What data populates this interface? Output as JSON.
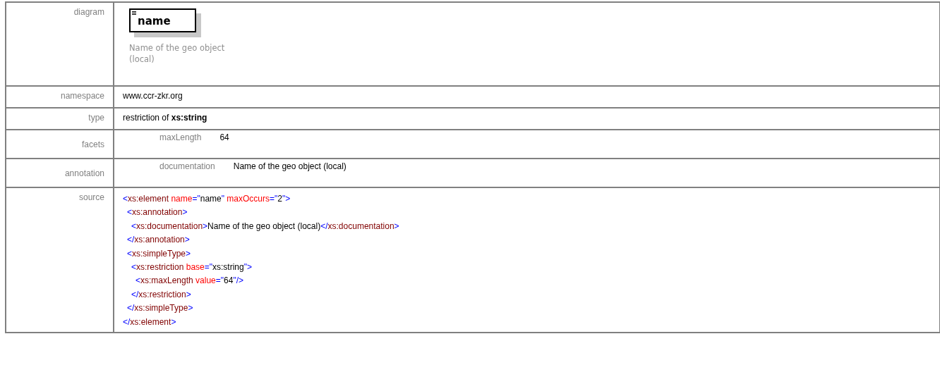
{
  "rows": [
    {
      "kind": "diagram",
      "label": "diagram",
      "element_name": "name",
      "caption": "Name of the geo object (local)"
    },
    {
      "kind": "text",
      "label": "namespace",
      "value": "www.ccr-zkr.org"
    },
    {
      "kind": "rich",
      "label": "type",
      "value": "restriction of **xs:string**"
    },
    {
      "kind": "pair",
      "label": "facets",
      "key": "maxLength",
      "value": "64"
    },
    {
      "kind": "pair",
      "label": "annotation",
      "key": "documentation",
      "value": "Name of the geo object (local)"
    },
    {
      "kind": "source",
      "label": "source",
      "lines": [
        {
          "code": "<xs:element name=\"name\" maxOccurs=\"2\">",
          "children": [
            {
              "code": "<xs:annotation>",
              "children": [
                {
                  "code": "<xs:documentation>Name of the geo object (local)</xs:documentation>"
                }
              ]
            },
            {
              "code": "</xs:annotation>"
            },
            {
              "code": "<xs:simpleType>",
              "children": [
                {
                  "code": "<xs:restriction base=\"xs:string\">",
                  "children": [
                    {
                      "code": "<xs:maxLength value=\"64\"/>"
                    }
                  ]
                },
                {
                  "code": "</xs:restriction>"
                }
              ]
            },
            {
              "code": "</xs:simpleType>"
            }
          ]
        },
        {
          "code": "</xs:element>"
        }
      ]
    }
  ]
}
